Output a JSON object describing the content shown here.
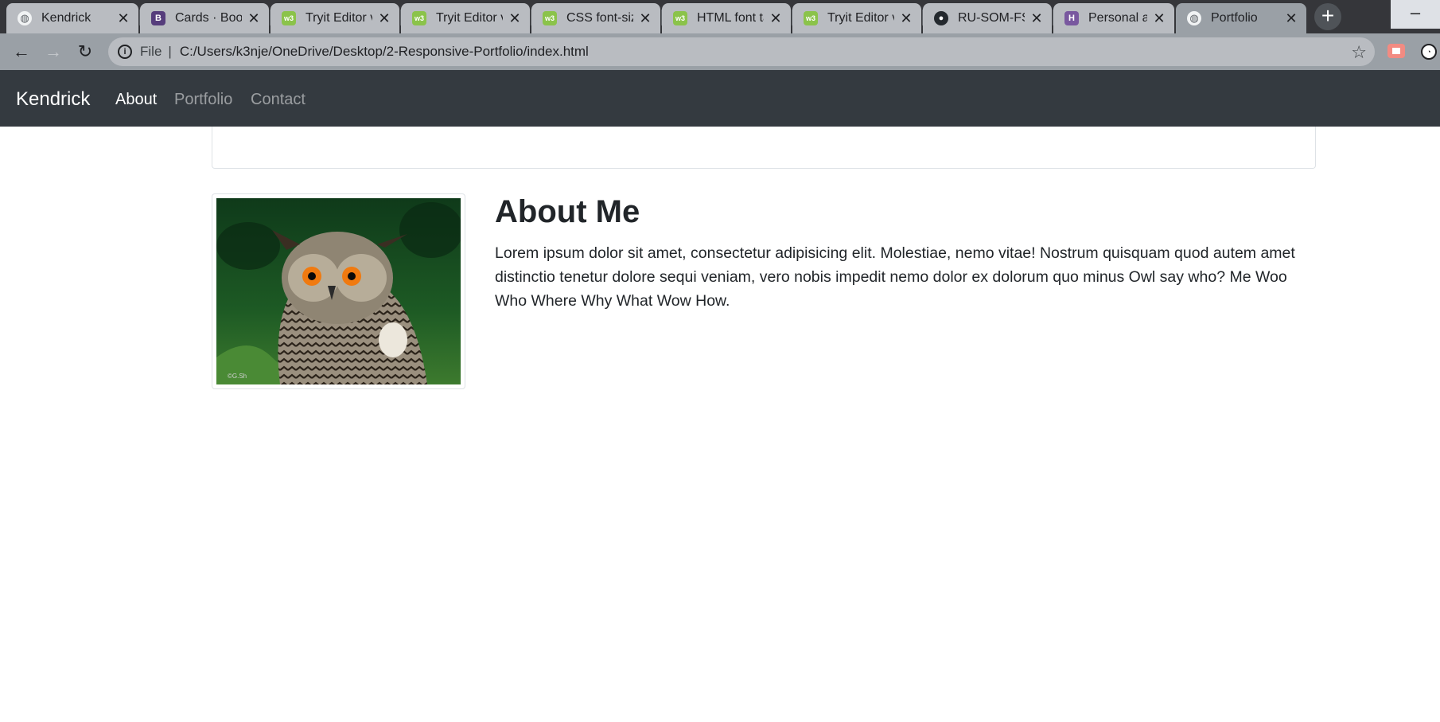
{
  "browser": {
    "tabs": [
      {
        "title": "Kendrick",
        "icon": "globe-icon",
        "active": false
      },
      {
        "title": "Cards · Boots",
        "icon": "bootstrap-icon",
        "active": false
      },
      {
        "title": "Tryit Editor v",
        "icon": "w3schools-icon",
        "active": false
      },
      {
        "title": "Tryit Editor v",
        "icon": "w3schools-icon",
        "active": false
      },
      {
        "title": "CSS font-size",
        "icon": "w3schools-icon",
        "active": false
      },
      {
        "title": "HTML font ta",
        "icon": "w3schools-icon",
        "active": false
      },
      {
        "title": "Tryit Editor v",
        "icon": "w3schools-icon",
        "active": false
      },
      {
        "title": "RU-SOM-FSF",
        "icon": "github-icon",
        "active": false
      },
      {
        "title": "Personal app",
        "icon": "heroku-icon",
        "active": false
      },
      {
        "title": "Portfolio",
        "icon": "globe-icon",
        "active": true
      }
    ],
    "address": {
      "scheme": "File",
      "url": "C:/Users/k3nje/OneDrive/Desktop/2-Responsive-Portfolio/index.html"
    }
  },
  "navbar": {
    "brand": "Kendrick",
    "links": [
      {
        "label": "About",
        "active": true
      },
      {
        "label": "Portfolio",
        "active": false
      },
      {
        "label": "Contact",
        "active": false
      }
    ]
  },
  "about": {
    "title": "About Me",
    "text": "Lorem ipsum dolor sit amet, consectetur adipisicing elit. Molestiae, nemo vitae! Nostrum quisquam quod autem amet distinctio tenetur dolore sequi veniam, vero nobis impedit nemo dolor ex dolorum quo minus Owl say who? Me Woo Who Where Why What Wow How.",
    "image_caption": "©G.Sh"
  },
  "colors": {
    "navbar_bg": "#343a40",
    "text": "#212529",
    "border": "#dee2e6"
  }
}
